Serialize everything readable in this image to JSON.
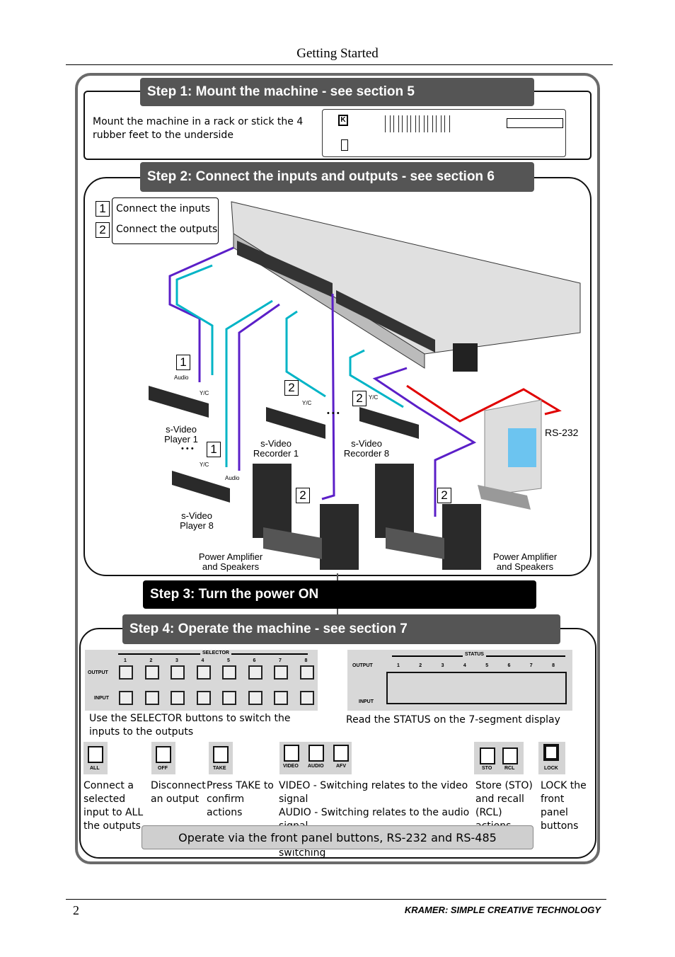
{
  "header": {
    "title": "Getting Started"
  },
  "step1": {
    "title": "Step 1: Mount the machine - see section 5",
    "text": "Mount the machine in a rack or stick the 4 rubber feet to the underside"
  },
  "step2": {
    "title": "Step 2: Connect the inputs and outputs - see section 6",
    "legend": [
      {
        "num": "1",
        "label": "Connect the inputs"
      },
      {
        "num": "2",
        "label": "Connect the outputs"
      }
    ],
    "labels": {
      "player1": "s-Video\nPlayer 1",
      "player8": "s-Video\nPlayer 8",
      "recorder1": "s-Video\nRecorder 1",
      "recorder8": "s-Video\nRecorder 8",
      "amp_left": "Power Amplifier\nand Speakers",
      "amp_right": "Power Amplifier\nand Speakers",
      "rs232": "RS-232",
      "audio": "Audio",
      "yc": "Y/C",
      "ellipsis": "• • •",
      "n1": "1",
      "n2": "2"
    },
    "colors": {
      "input_cable": "#00b4c6",
      "output_cable": "#5b1fc8",
      "rs232_cable": "#e00000"
    }
  },
  "step3": {
    "title": "Step 3: Turn the power ON"
  },
  "step4": {
    "title": "Step 4: Operate the machine - see section 7",
    "selector": {
      "label": "SELECTOR",
      "numbers": [
        "1",
        "2",
        "3",
        "4",
        "5",
        "6",
        "7",
        "8"
      ],
      "output": "OUTPUT",
      "input": "INPUT",
      "caption": "Use the SELECTOR buttons to switch the inputs to the outputs"
    },
    "status": {
      "label": "STATUS",
      "numbers": [
        "1",
        "2",
        "3",
        "4",
        "5",
        "6",
        "7",
        "8"
      ],
      "output": "OUTPUT",
      "input": "INPUT",
      "caption": "Read the  STATUS on the 7-segment display"
    },
    "buttons": [
      {
        "label": "ALL",
        "desc": "Connect a selected input to ALL the outputs"
      },
      {
        "label": "OFF",
        "desc": "Disconnect an output"
      },
      {
        "label": "TAKE",
        "desc": "Press TAKE to confirm actions"
      },
      {
        "label": "VIDEO"
      },
      {
        "label": "AUDIO"
      },
      {
        "label": "AFV"
      },
      {
        "label": "STO"
      },
      {
        "label": "RCL"
      },
      {
        "label": "LOCK",
        "desc": "LOCK the front panel buttons"
      }
    ],
    "mode_desc": [
      "VIDEO - Switching relates to the video signal",
      "AUDIO - Switching relates to the audio signal",
      "AFV - Audio follows video when switching"
    ],
    "store_desc": "Store (STO) and recall (RCL) actions",
    "banner": "Operate via the front panel buttons, RS-232 and RS-485"
  },
  "footer": {
    "page": "2",
    "brand": "KRAMER:  SIMPLE CREATIVE TECHNOLOGY"
  }
}
